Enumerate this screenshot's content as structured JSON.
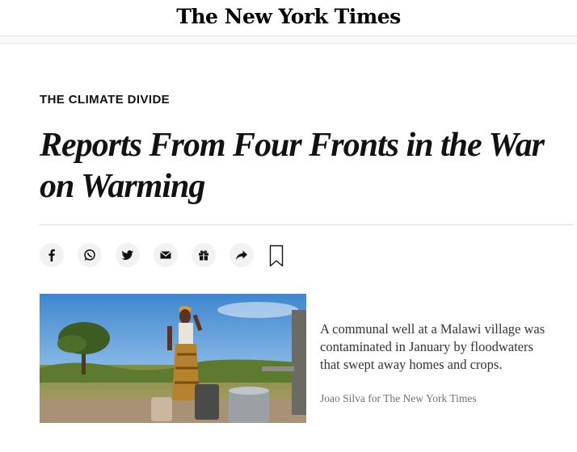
{
  "header": {
    "logo": "The New York Times"
  },
  "article": {
    "kicker": "THE CLIMATE DIVIDE",
    "headline": "Reports From Four Fronts in the War on Warming"
  },
  "share": {
    "buttons": [
      {
        "icon": "facebook-icon"
      },
      {
        "icon": "whatsapp-icon"
      },
      {
        "icon": "twitter-icon"
      },
      {
        "icon": "email-icon"
      },
      {
        "icon": "gift-icon"
      },
      {
        "icon": "share-icon"
      }
    ],
    "bookmark_icon": "bookmark-icon"
  },
  "figure": {
    "caption": "A communal well at a Malawi village was contaminated in January by floodwaters that swept away homes and crops.",
    "credit": "Joao Silva for The New York Times"
  },
  "colors": {
    "text": "#121212",
    "caption": "#333333",
    "credit": "#727272",
    "button_bg": "#f2f2f2"
  }
}
